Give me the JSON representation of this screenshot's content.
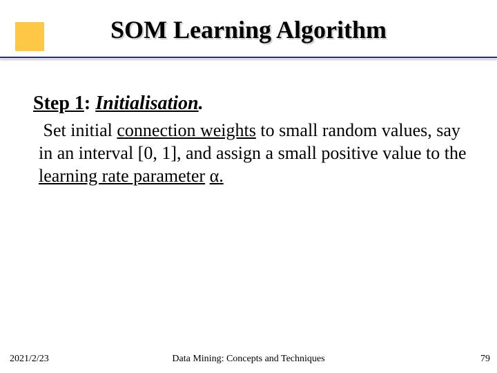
{
  "accent_color": "#fec846",
  "rule_color": "#1d2e8e",
  "title": "SOM Learning Algorithm",
  "step": {
    "label": "Step 1",
    "name": "Initialisation",
    "colon": ":",
    "dot": "."
  },
  "body": {
    "lead": "Set initial ",
    "u1": "connection weights",
    "mid1": " to small random values, say in an interval [0, 1], and assign a small positive value to the ",
    "u2": "learning rate parameter",
    "space": " ",
    "alpha": "α",
    "tail": "."
  },
  "footer": {
    "date": "2021/2/23",
    "center": "Data Mining: Concepts and Techniques",
    "page": "79"
  }
}
